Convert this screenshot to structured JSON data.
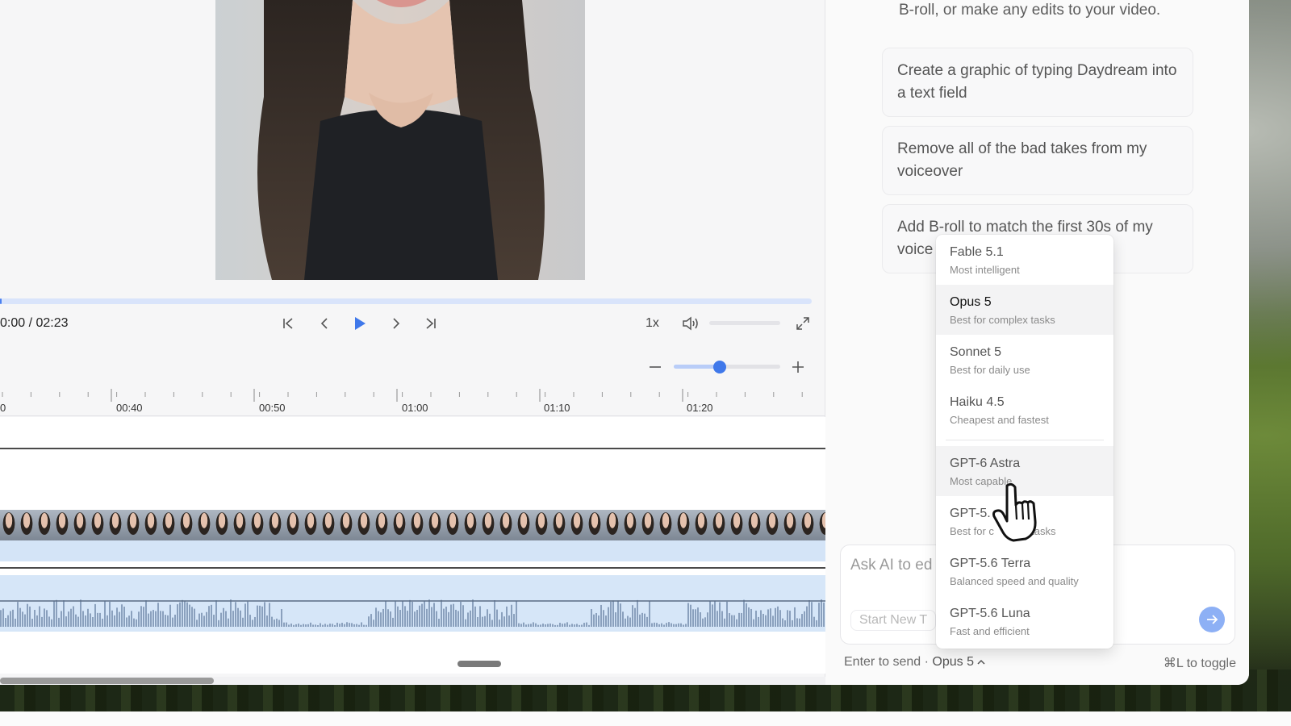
{
  "player": {
    "time_readout": "0:00 / 02:23",
    "speed_label": "1x",
    "progress": 0.0
  },
  "timeline": {
    "ruler_labels": [
      "0",
      "00:40",
      "00:50",
      "01:00",
      "01:10",
      "01:20"
    ],
    "zoom_level": 0.43
  },
  "chat": {
    "intro_text": "B-roll, or make any edits to your video.",
    "suggestions": [
      "Create a graphic of typing Daydream into a text field",
      "Remove all of the bad takes from my voiceover",
      "Add B-roll to match the first 30s of my voice"
    ],
    "composer": {
      "placeholder": "Ask AI to ed",
      "new_task_label": "Start New T"
    },
    "footer": {
      "send_hint": "Enter to send",
      "separator": "·",
      "model": "Opus 5",
      "toggle_hint": "⌘L to toggle"
    }
  },
  "model_menu": {
    "options": [
      {
        "name": "Fable 5.1",
        "desc": "Most intelligent"
      },
      {
        "name": "Opus 5",
        "desc": "Best for complex tasks"
      },
      {
        "name": "Sonnet 5",
        "desc": "Best for daily use"
      },
      {
        "name": "Haiku 4.5",
        "desc": "Cheapest and fastest"
      },
      {
        "name": "GPT-6 Astra",
        "desc": "Most capable"
      },
      {
        "name": "GPT-5.",
        "desc": "Best for c          x tasks"
      },
      {
        "name": "GPT-5.6 Terra",
        "desc": "Balanced speed and quality"
      },
      {
        "name": "GPT-5.6 Luna",
        "desc": "Fast and efficient"
      }
    ],
    "selected": "Opus 5",
    "hovered": "GPT-6 Astra"
  },
  "colors": {
    "accent": "#3f78ea",
    "send_button": "#8db0f5",
    "track_blue": "#d6e6f8"
  }
}
